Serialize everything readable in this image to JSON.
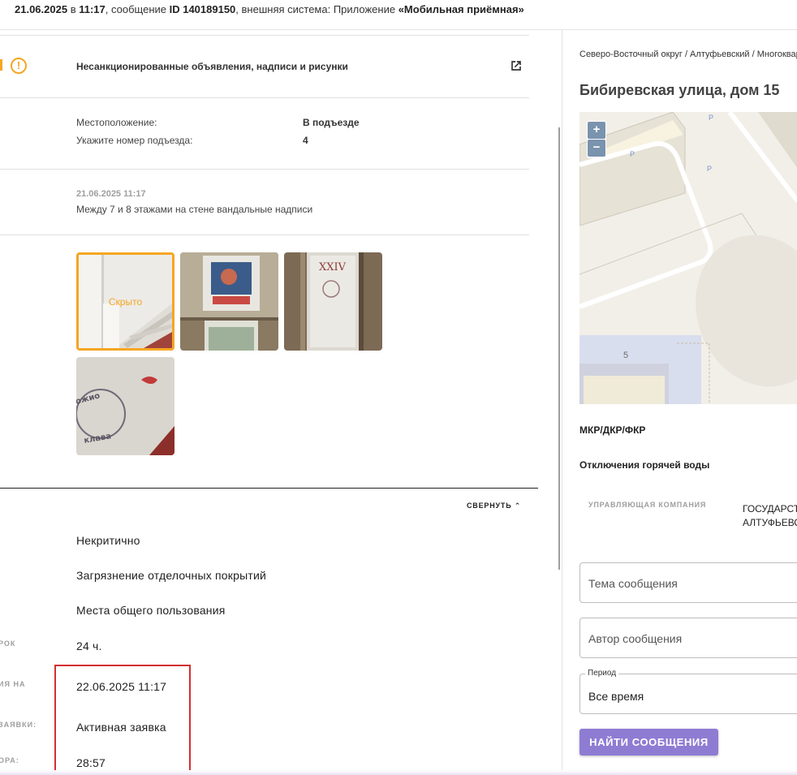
{
  "header": {
    "date": "21.06.2025",
    "time_prefix": " в ",
    "time": "11:17",
    "message_prefix": ", сообщение ",
    "message_id": "ID 140189150",
    "system_prefix": ", внешняя система: Приложение ",
    "system_name": "«Мобильная приёмная»"
  },
  "category": {
    "title": "Несанкционированные объявления, надписи и рисунки",
    "icon": "exclamation-icon",
    "accent": "#f5a623"
  },
  "location": {
    "location_label": "Местоположение:",
    "location_value": "В подъезде",
    "entrance_label": "Укажите номер подъезда:",
    "entrance_value": "4"
  },
  "message": {
    "date": "21.06.2025 11:17",
    "text": "Между 7 и 8 этажами на стене вандальные надписи"
  },
  "photos": {
    "hidden_label": "Скрыто"
  },
  "details": {
    "collapse_label": "СВЕРНУТЬ",
    "rows": [
      {
        "label": "",
        "value": "Некритично"
      },
      {
        "label": "",
        "value": "Загрязнение отделочных покрытий"
      },
      {
        "label": "",
        "value": "Места общего пользования"
      },
      {
        "label": "РОК",
        "value": "24 ч."
      },
      {
        "label": "ИЯ НА",
        "value": "22.06.2025 11:17"
      },
      {
        "label": "ЗАЯВКИ:",
        "value": "Активная заявка"
      },
      {
        "label": "ОРА:",
        "value": "28:57"
      }
    ]
  },
  "sidebar": {
    "breadcrumb": "Северо-Восточный округ / Алтуфьевский / Многоквартирный дом",
    "address": "Бибиревская улица, дом 15",
    "map": {
      "zoom_in": "+",
      "zoom_out": "−",
      "building_number": "5",
      "parking": "P"
    },
    "mkr_label": "МКР/ДКР/ФКР",
    "hot_water_label": "Отключения горячей воды",
    "uk_label": "УПРАВЛЯЮЩАЯ КОМПАНИЯ",
    "uk_value_line1": "ГОСУДАРСТВЕННОЕ",
    "uk_value_line2": "АЛТУФЬЕВСКОГО",
    "topic_placeholder": "Тема сообщения",
    "author_placeholder": "Автор сообщения",
    "period_label": "Период",
    "period_value": "Все время",
    "find_button": "НАЙТИ СООБЩЕНИЯ",
    "button_color": "#8e7cd3"
  }
}
